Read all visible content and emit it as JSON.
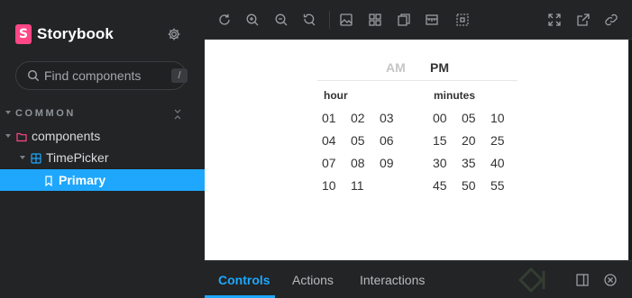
{
  "sidebar": {
    "brand": {
      "logo_letter": "S",
      "name": "Storybook"
    },
    "search": {
      "placeholder": "Find components",
      "shortcut": "/"
    },
    "group": {
      "label": "COMMON"
    },
    "tree": {
      "components": "components",
      "timepicker": "TimePicker",
      "primary": "Primary"
    }
  },
  "toolbar": {
    "left_icons": [
      "reload-icon",
      "zoom-in-icon",
      "zoom-out-icon",
      "zoom-reset-icon",
      "background-icon",
      "grid-icon",
      "viewport-icon",
      "measure-icon",
      "outline-icon"
    ],
    "right_icons": [
      "fullscreen-icon",
      "open-new-tab-icon",
      "copy-link-icon"
    ]
  },
  "timepicker": {
    "am": "AM",
    "pm": "PM",
    "hour_label": "hour",
    "minutes_label": "minutes",
    "hours": [
      [
        "01",
        "02",
        "03"
      ],
      [
        "04",
        "05",
        "06"
      ],
      [
        "07",
        "08",
        "09"
      ],
      [
        "10",
        "11"
      ]
    ],
    "minutes": [
      [
        "00",
        "05",
        "10"
      ],
      [
        "15",
        "20",
        "25"
      ],
      [
        "30",
        "35",
        "40"
      ],
      [
        "45",
        "50",
        "55"
      ]
    ]
  },
  "panel": {
    "tabs": [
      "Controls",
      "Actions",
      "Interactions"
    ],
    "active_tab": "Controls"
  },
  "colors": {
    "accent": "#1ea7fd",
    "brand": "#ff4785",
    "sidebar_bg": "#222425"
  }
}
